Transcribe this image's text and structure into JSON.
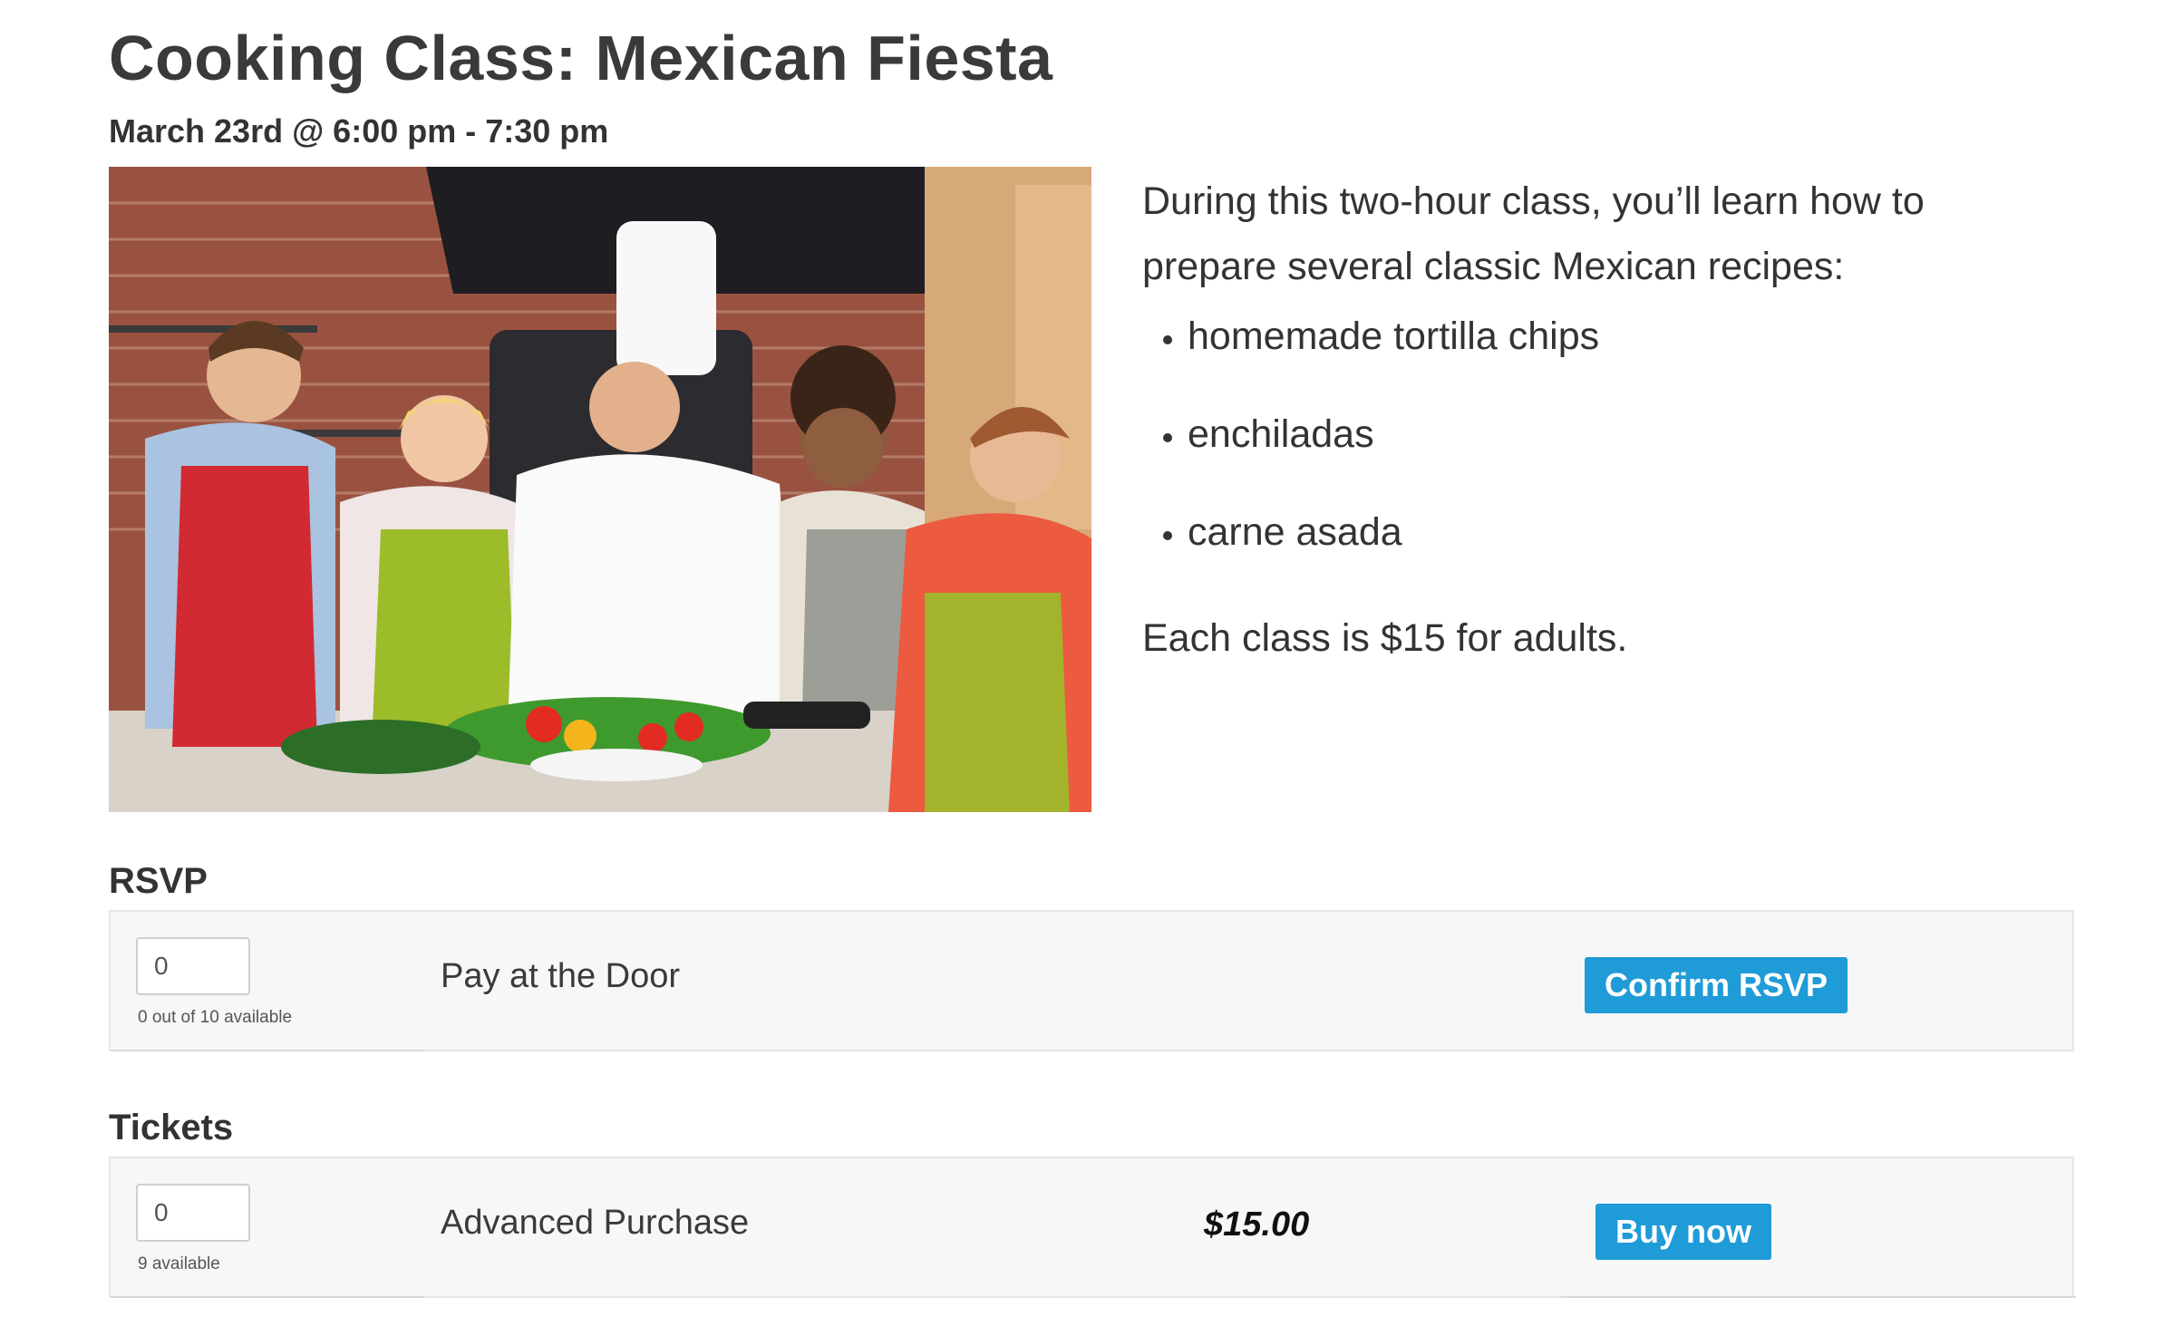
{
  "event": {
    "title": "Cooking Class: Mexican Fiesta",
    "datetime": "March 23rd @ 6:00 pm - 7:30 pm"
  },
  "description": {
    "intro": "During this two-hour class, you’ll learn how to prepare several classic Mexican recipes:",
    "recipes": [
      "homemade tortilla chips",
      "enchiladas",
      "carne asada"
    ],
    "price_note": "Each class is $15 for adults."
  },
  "rsvp": {
    "heading": "RSVP",
    "quantity_value": "0",
    "availability": "0 out of 10 available",
    "ticket_name": "Pay at the Door",
    "button_label": "Confirm RSVP"
  },
  "tickets": {
    "heading": "Tickets",
    "quantity_value": "0",
    "availability": "9 available",
    "ticket_name": "Advanced Purchase",
    "price": "$15.00",
    "button_label": "Buy now"
  },
  "colors": {
    "button_blue": "#1f9bd8",
    "row_background": "#f7f7f7",
    "heading_text": "#3a3a3a"
  }
}
